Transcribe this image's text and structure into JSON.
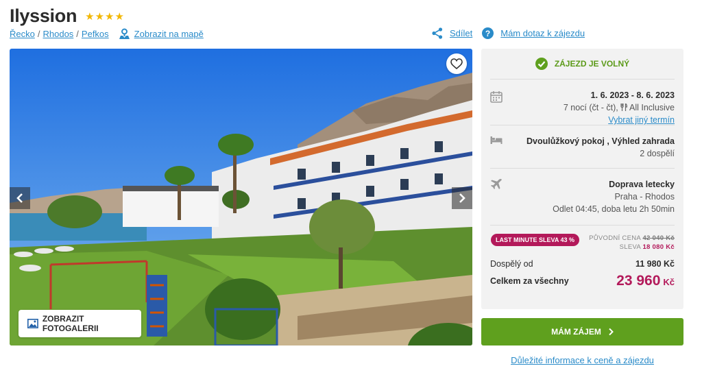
{
  "hotel": {
    "name": "Ilyssion",
    "stars_text": "★★★★"
  },
  "breadcrumb": {
    "items": [
      "Řecko",
      "Rhodos",
      "Pefkos"
    ],
    "map_link": "Zobrazit na mapě"
  },
  "actions": {
    "share": "Sdílet",
    "question": "Mám dotaz k zájezdu"
  },
  "gallery": {
    "button_label": "ZOBRAZIT FOTOGALERII"
  },
  "panel": {
    "status": "ZÁJEZD JE VOLNÝ",
    "dates": "1. 6. 2023 - 8. 6. 2023",
    "nights": "7 nocí (čt - čt),",
    "board": "All Inclusive",
    "change_term": "Vybrat jiný termín",
    "room": "Dvoulůžkový pokoj , Výhled zahrada",
    "persons": "2 dospělí",
    "transport_title": "Doprava letecky",
    "route": "Praha - Rhodos",
    "departure": "Odlet 04:45, doba letu 2h 50min",
    "badge": "LAST MINUTE SLEVA 43 %",
    "orig_label": "PŮVODNÍ CENA",
    "orig_price": "42 040 Kč",
    "discount_label": "SLEVA",
    "discount_value": "18 080 Kč",
    "adult_label": "Dospělý od",
    "adult_price": "11 980 Kč",
    "total_label": "Celkem za všechny",
    "total_price": "23 960",
    "currency": "Kč"
  },
  "cta": {
    "label": "MÁM ZÁJEM"
  },
  "info_link": "Důležité informace k ceně a zájezdu",
  "colors": {
    "link": "#2a8bc9",
    "green": "#5fa01e",
    "price": "#b3195a",
    "star": "#f2b705"
  }
}
